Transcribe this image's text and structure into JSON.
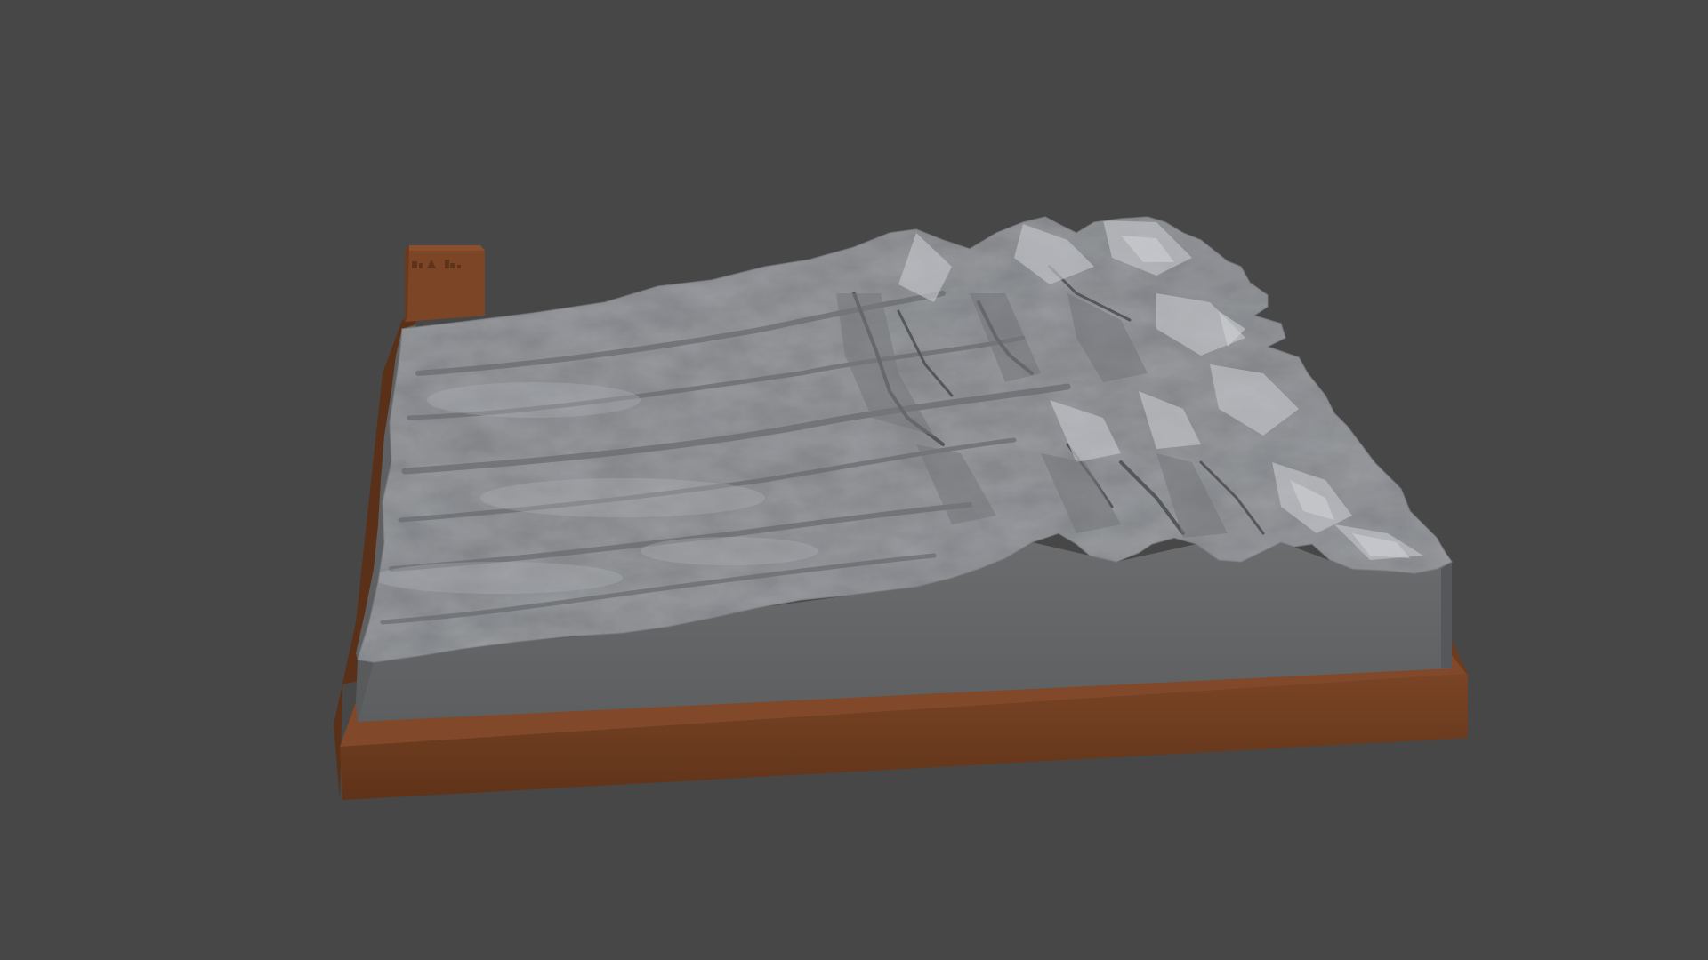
{
  "scene": {
    "subject": "terrain-relief-model",
    "colors": {
      "background": "#474747",
      "terrain_light": "#a9abaf",
      "terrain_mid": "#8e9094",
      "terrain_shadow": "#6c6e72",
      "terrain_side": "#626465",
      "base_top": "#82482a",
      "base_front": "#6b3c20",
      "base_side": "#5a3118"
    }
  }
}
